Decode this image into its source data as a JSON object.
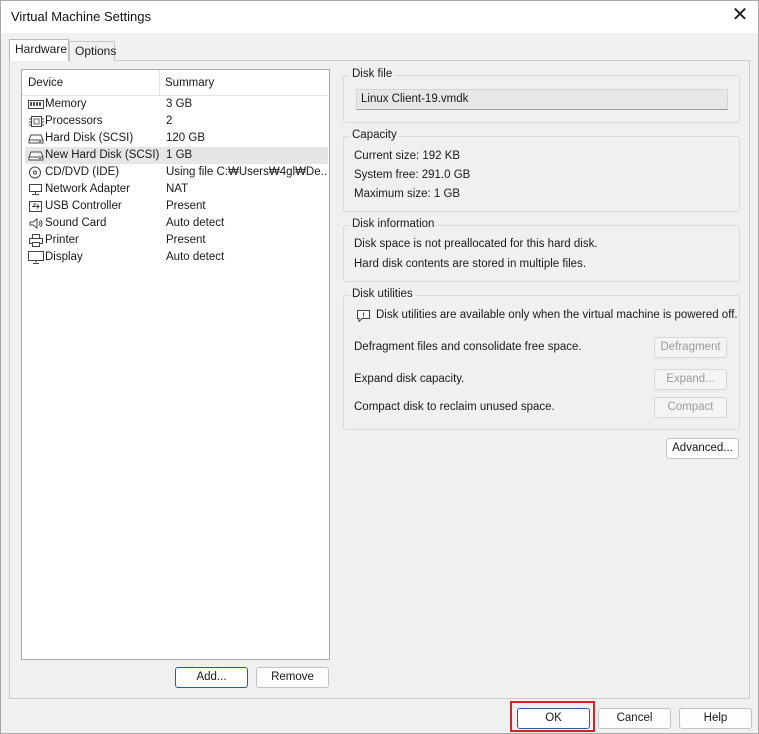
{
  "window": {
    "title": "Virtual Machine Settings",
    "close_glyph": "✕"
  },
  "tabs": [
    {
      "label": "Hardware",
      "active": true
    },
    {
      "label": "Options",
      "active": false
    }
  ],
  "device_list": {
    "columns": [
      "Device",
      "Summary"
    ],
    "rows": [
      {
        "icon": "memory-icon",
        "device": "Memory",
        "summary": "3 GB"
      },
      {
        "icon": "processor-icon",
        "device": "Processors",
        "summary": "2"
      },
      {
        "icon": "hard-disk-icon",
        "device": "Hard Disk (SCSI)",
        "summary": "120 GB"
      },
      {
        "icon": "hard-disk-icon",
        "device": "New Hard Disk (SCSI)",
        "summary": "1 GB",
        "selected": true
      },
      {
        "icon": "cd-dvd-icon",
        "device": "CD/DVD (IDE)",
        "summary": "Using file C:₩Users₩4gl₩De..."
      },
      {
        "icon": "network-adapter-icon",
        "device": "Network Adapter",
        "summary": "NAT"
      },
      {
        "icon": "usb-icon",
        "device": "USB Controller",
        "summary": "Present"
      },
      {
        "icon": "sound-icon",
        "device": "Sound Card",
        "summary": "Auto detect"
      },
      {
        "icon": "printer-icon",
        "device": "Printer",
        "summary": "Present"
      },
      {
        "icon": "display-icon",
        "device": "Display",
        "summary": "Auto detect"
      }
    ],
    "add_label": "Add...",
    "remove_label": "Remove"
  },
  "disk_file": {
    "legend": "Disk file",
    "value": "Linux Client-19.vmdk"
  },
  "capacity": {
    "legend": "Capacity",
    "current_size": "Current size:  192 KB",
    "system_free": "System free:  291.0 GB",
    "maximum_size": "Maximum size:  1 GB"
  },
  "disk_information": {
    "legend": "Disk information",
    "line1": "Disk space is not preallocated for this hard disk.",
    "line2": "Hard disk contents are stored in multiple files."
  },
  "disk_utilities": {
    "legend": "Disk utilities",
    "notice": "Disk utilities are available only when the virtual machine is powered off.",
    "defragment_text": "Defragment files and consolidate free space.",
    "defragment_label": "Defragment",
    "expand_text": "Expand disk capacity.",
    "expand_label": "Expand...",
    "compact_text": "Compact disk to reclaim unused space.",
    "compact_label": "Compact"
  },
  "advanced_label": "Advanced...",
  "footer": {
    "ok_label": "OK",
    "cancel_label": "Cancel",
    "help_label": "Help"
  },
  "colors": {
    "highlight": "#d6202a",
    "accent": "#1f5fa8",
    "selected_row": "#e6e6e6"
  }
}
